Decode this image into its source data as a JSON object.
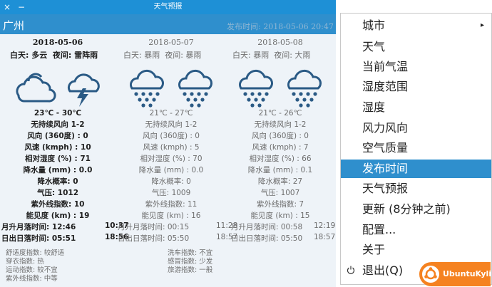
{
  "window": {
    "title": "天气预报",
    "close_glyph": "×",
    "min_glyph": "−"
  },
  "city": "广州",
  "publish_time": "发布时间: 2018-05-06 20:47",
  "days": [
    {
      "date": "2018-05-06",
      "day": "白天: 多云",
      "night": "夜间: 雷阵雨",
      "day_icon": "cloudy-icon",
      "night_icon": "thunderstorm-icon",
      "temp": "23℃ - 30℃",
      "wind": "无持续风向 1-2",
      "wind_dir": "风向 (360度) : 0",
      "wind_speed": "风速 (kmph) : 10",
      "humidity": "相对湿度 (%) : 71",
      "precip": "降水量 (mm) : 0.0",
      "precip_prob": "降水概率: 0",
      "pressure": "气压: 1012",
      "uv": "紫外线指数: 10",
      "visibility": "能见度 (km) : 19"
    },
    {
      "date": "2018-05-07",
      "day": "白天: 暴雨",
      "night": "夜间: 暴雨",
      "day_icon": "heavy-rain-icon",
      "night_icon": "heavy-rain-icon",
      "temp": "21℃ - 27℃",
      "wind": "无持续风向 1-2",
      "wind_dir": "风向 (360度) : 0",
      "wind_speed": "风速 (kmph) : 5",
      "humidity": "相对湿度 (%) : 70",
      "precip": "降水量 (mm) : 0.0",
      "precip_prob": "降水概率: 0",
      "pressure": "气压: 1009",
      "uv": "紫外线指数: 11",
      "visibility": "能见度 (km) : 16"
    },
    {
      "date": "2018-05-08",
      "day": "白天: 暴雨",
      "night": "夜间: 大雨",
      "day_icon": "heavy-rain-icon",
      "night_icon": "heavy-rain-icon",
      "temp": "21℃ - 26℃",
      "wind": "无持续风向 1-2",
      "wind_dir": "风向 (360度) : 0",
      "wind_speed": "风速 (kmph) : 7",
      "humidity": "相对湿度 (%) : 66",
      "precip": "降水量 (mm) : 0.1",
      "precip_prob": "降水概率: 27",
      "pressure": "气压: 1007",
      "uv": "紫外线指数: 7",
      "visibility": "能见度 (km) : 15"
    }
  ],
  "sun": {
    "moon_row": [
      "月升月落时间: 12:46",
      "10:37",
      "月升月落时间: 00:15",
      "11:28",
      "月升月落时间: 00:58",
      "12:19"
    ],
    "sun_row": [
      "日出日落时间: 05:51",
      "18:56",
      "日出日落时间: 05:50",
      "18:57",
      "日出日落时间: 05:50",
      "18:57"
    ]
  },
  "indices": {
    "comfort": "舒适度指数: 较舒适",
    "dressing": "穿衣指数: 热",
    "sport": "运动指数: 较不宜",
    "uv": "紫外线指数: 中等",
    "carwash": "洗车指数: 不宜",
    "cold": "感冒指数: 少发",
    "travel": "旅游指数: 一般"
  },
  "menu": {
    "items": [
      "城市",
      "天气",
      "当前气温",
      "湿度范围",
      "湿度",
      "风力风向",
      "空气质量",
      "发布时间",
      "天气预报",
      "更新 (8分钟之前)",
      "配置...",
      "关于",
      "退出(Q)"
    ],
    "selected_index": 7,
    "submenu_arrow": "▸"
  },
  "brand": {
    "text": "UbuntuKylin",
    "color": "#f58220"
  },
  "colors": {
    "titlebar": "#1e90d6",
    "accent": "#2f8fcd",
    "icon": "#2a5a85"
  }
}
